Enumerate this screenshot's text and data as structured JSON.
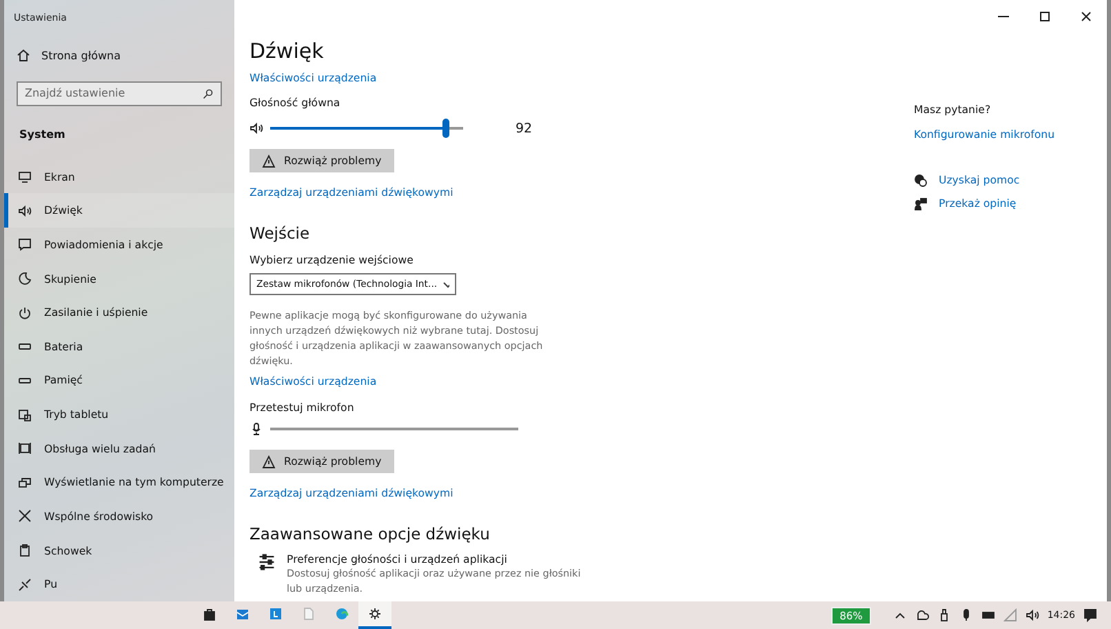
{
  "window": {
    "title": "Ustawienia"
  },
  "sidebar": {
    "home": "Strona główna",
    "search": {
      "placeholder": "Znajdź ustawienie"
    },
    "section": "System",
    "items": [
      {
        "label": "Ekran",
        "selected": false
      },
      {
        "label": "Dźwięk",
        "selected": true
      },
      {
        "label": "Powiadomienia i akcje",
        "selected": false
      },
      {
        "label": "Skupienie",
        "selected": false
      },
      {
        "label": "Zasilanie i uśpienie",
        "selected": false
      },
      {
        "label": "Bateria",
        "selected": false
      },
      {
        "label": "Pamięć",
        "selected": false
      },
      {
        "label": "Tryb tabletu",
        "selected": false
      },
      {
        "label": "Obsługa wielu zadań",
        "selected": false
      },
      {
        "label": "Wyświetlanie na tym komputerze",
        "selected": false
      },
      {
        "label": "Wspólne środowisko",
        "selected": false
      },
      {
        "label": "Schowek",
        "selected": false
      },
      {
        "label": "Pu",
        "selected": false
      }
    ]
  },
  "main": {
    "title": "Dźwięk",
    "output": {
      "properties_link": "Właściwości urządzenia",
      "volume_label": "Głośność główna",
      "volume": {
        "level": 0.91,
        "reading": "92"
      },
      "troubleshoot": "Rozwiąż problemy",
      "manage_link": "Zarządzaj urządzeniami dźwiękowymi"
    },
    "input": {
      "heading": "Wejście",
      "select_label": "Wybierz urządzenie wejściowe",
      "select_value": "Zestaw mikrofonów (Technologia Int...",
      "description": "Pewne aplikacje mogą być skonfigurowane do używania innych urządzeń dźwiękowych niż wybrane tutaj. Dostosuj głośność i urządzenia aplikacji w zaawansowanych opcjach dźwięku.",
      "properties_link": "Właściwości urządzenia",
      "test_label": "Przetestuj mikrofon",
      "mic": {
        "level": 0
      },
      "troubleshoot": "Rozwiąż problemy",
      "manage_link": "Zarządzaj urządzeniami dźwiękowymi"
    },
    "advanced": {
      "heading": "Zaawansowane opcje dźwięku",
      "item_title": "Preferencje głośności i urządzeń aplikacji",
      "item_description": "Dostosuj głośność aplikacji oraz używane przez nie głośniki lub urządzenia."
    }
  },
  "aside": {
    "question": "Masz pytanie?",
    "link": "Konfigurowanie mikrofonu",
    "help": [
      {
        "kind": "help",
        "label": "Uzyskaj pomoc"
      },
      {
        "kind": "feedback",
        "label": "Przekaż opinię"
      }
    ]
  },
  "taskbar": {
    "apps": [
      {
        "kind": "store",
        "selected": false
      },
      {
        "kind": "mail",
        "selected": false
      },
      {
        "kind": "tile",
        "selected": false
      },
      {
        "kind": "file",
        "selected": false
      },
      {
        "kind": "browser",
        "selected": false
      },
      {
        "kind": "settings",
        "selected": true
      }
    ],
    "battery_badge": "86%",
    "time": "14:26"
  }
}
